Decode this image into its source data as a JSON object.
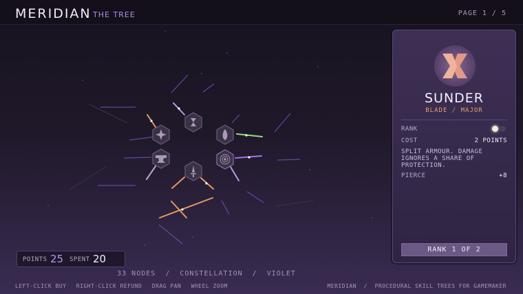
{
  "header": {
    "title": "MERIDIAN",
    "subtitle": "THE TREE",
    "page_indicator": "PAGE 1 / 5"
  },
  "tree": {
    "nodes": [
      {
        "icon": "hourglass-icon"
      },
      {
        "icon": "flame-icon"
      },
      {
        "icon": "target-icon"
      },
      {
        "icon": "dagger-icon"
      },
      {
        "icon": "anvil-icon"
      },
      {
        "icon": "sparkle-icon"
      }
    ]
  },
  "panel": {
    "icon": "sunder-icon",
    "name": "SUNDER",
    "tag1": "BLADE",
    "tag_sep": "/",
    "tag2": "MAJOR",
    "rank_label": "RANK",
    "rank_current": 1,
    "rank_max": 2,
    "cost_label": "COST",
    "cost_value": "2 POINTS",
    "description": "SPLIT ARMOUR. DAMAGE IGNORES A SHARE OF PROTECTION.",
    "stat_label": "PIERCE",
    "stat_value": "+8",
    "rank_button": "RANK 1 OF 2"
  },
  "points": {
    "points_label": "POINTS",
    "points_value": "25",
    "spent_label": "SPENT",
    "spent_value": "20"
  },
  "summary": "33 NODES  /  CONSTELLATION  /  VIOLET",
  "footer": {
    "hints": [
      "LEFT-CLICK BUY",
      "RIGHT-CLICK REFUND",
      "DRAG PAN",
      "WHEEL ZOOM"
    ],
    "credit": "MERIDIAN  /  PROCEDURAL SKILL TREES FOR GAMEMAKER"
  },
  "colors": {
    "accent": "#b995f2",
    "tag": "#e7a06b",
    "node": "#4a4054",
    "link_orange": "#e79a63",
    "link_green": "#8ee07a",
    "link_violet": "#a772e8"
  }
}
